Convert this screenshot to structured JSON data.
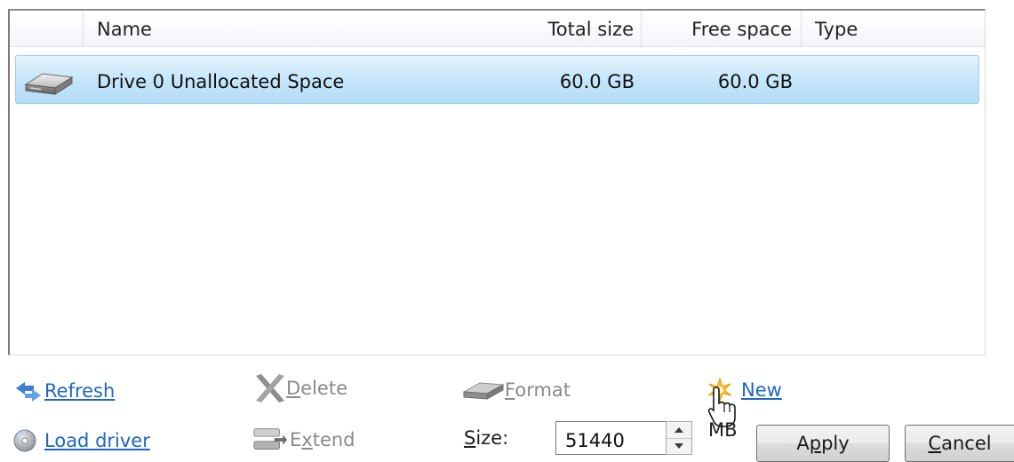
{
  "columns": {
    "name": "Name",
    "total_size": "Total size",
    "free_space": "Free space",
    "type": "Type"
  },
  "rows": [
    {
      "icon": "drive-icon",
      "name": "Drive 0 Unallocated Space",
      "total_size": "60.0 GB",
      "free_space": "60.0 GB",
      "type": "",
      "selected": true
    }
  ],
  "actions": {
    "refresh": {
      "pre": "",
      "key": "R",
      "post": "efresh",
      "icon": "refresh-icon",
      "enabled": true
    },
    "load_driver": {
      "pre": "",
      "key": "L",
      "post": "oad driver",
      "icon": "load-driver-icon",
      "enabled": true
    },
    "delete": {
      "pre": "",
      "key": "D",
      "post": "elete",
      "icon": "delete-icon",
      "enabled": false
    },
    "extend": {
      "pre": "E",
      "key": "x",
      "post": "tend",
      "icon": "extend-icon",
      "enabled": false
    },
    "format": {
      "pre": "",
      "key": "F",
      "post": "ormat",
      "icon": "format-icon",
      "enabled": false
    },
    "new": {
      "pre": "N",
      "key": "e",
      "post": "w",
      "icon": "new-icon",
      "enabled": true
    }
  },
  "size": {
    "label_key": "S",
    "label_post": "ize:",
    "value": "51440",
    "unit": "MB"
  },
  "buttons": {
    "apply": {
      "pre": "A",
      "key": "p",
      "post": "ply"
    },
    "cancel": {
      "pre": "",
      "key": "C",
      "post": "ancel"
    }
  },
  "colors": {
    "selection": "#c6e6f9",
    "selection_border": "#9dd0ef",
    "link": "#1b67c2",
    "disabled": "#8a8a8a"
  }
}
